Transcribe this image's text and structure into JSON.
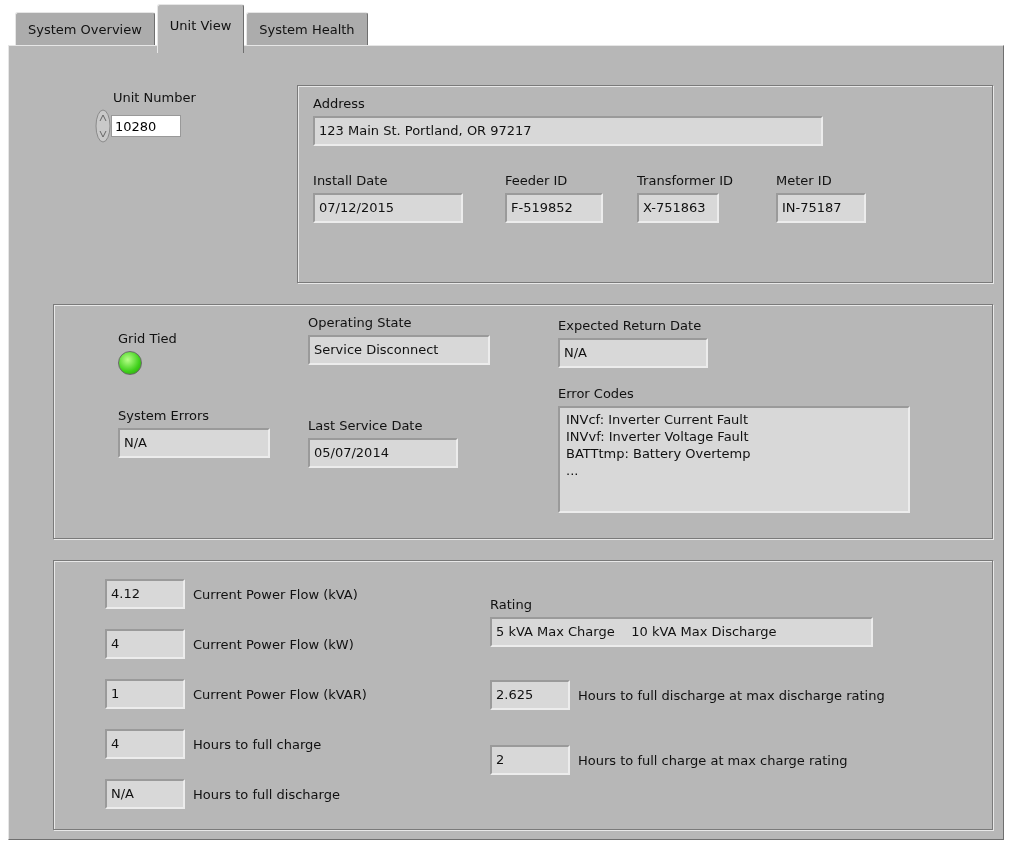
{
  "tabs": [
    {
      "label": "System Overview",
      "selected": false
    },
    {
      "label": "Unit View",
      "selected": true
    },
    {
      "label": "System Health",
      "selected": false
    }
  ],
  "unit_number": {
    "label": "Unit Number",
    "value": "10280"
  },
  "address": {
    "label": "Address",
    "value": "123 Main St. Portland, OR 97217"
  },
  "install_info": [
    {
      "label": "Install Date",
      "value": "07/12/2015"
    },
    {
      "label": "Feeder ID",
      "value": "F-519852"
    },
    {
      "label": "Transformer ID",
      "value": "X-751863"
    },
    {
      "label": "Meter ID",
      "value": "IN-75187"
    }
  ],
  "status": {
    "grid_tied": {
      "label": "Grid Tied",
      "on": true
    },
    "operating_state": {
      "label": "Operating State",
      "value": "Service Disconnect"
    },
    "system_errors": {
      "label": "System Errors",
      "value": "N/A"
    },
    "last_service_date": {
      "label": "Last Service Date",
      "value": "05/07/2014"
    },
    "expected_return_date": {
      "label": "Expected Return Date",
      "value": "N/A"
    },
    "error_codes": {
      "label": "Error Codes",
      "lines": [
        "INVcf: Inverter Current Fault",
        "INVvf: Inverter Voltage Fault",
        "BATTtmp: Battery Overtemp",
        "..."
      ]
    }
  },
  "power": [
    {
      "value": "4.12",
      "label": "Current Power Flow (kVA)"
    },
    {
      "value": "4",
      "label": "Current Power Flow (kW)"
    },
    {
      "value": "1",
      "label": "Current Power Flow (kVAR)"
    },
    {
      "value": "4",
      "label": "Hours to full charge"
    },
    {
      "value": "N/A",
      "label": "Hours to full discharge"
    }
  ],
  "rating": {
    "label": "Rating",
    "value": "5 kVA Max Charge    10 kVA Max Discharge"
  },
  "rating_rows": [
    {
      "value": "2.625",
      "label": "Hours to full discharge at max discharge rating"
    },
    {
      "value": "2",
      "label": "Hours to full charge at max charge rating"
    }
  ]
}
